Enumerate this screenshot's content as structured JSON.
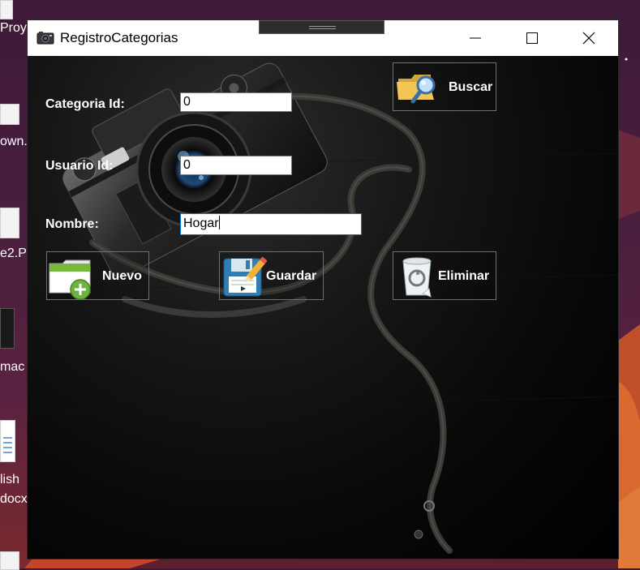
{
  "desktop": {
    "labels": [
      "Proy",
      "own..",
      "e2.P",
      "mac",
      "lish",
      "docx"
    ]
  },
  "window": {
    "title": "RegistroCategorias",
    "controls": {
      "minimize": "minimize-icon",
      "maximize": "maximize-icon",
      "close": "close-icon"
    }
  },
  "form": {
    "categoria_id": {
      "label": "Categoria Id:",
      "value": "0"
    },
    "usuario_id": {
      "label": "Usuario Id:",
      "value": "0"
    },
    "nombre": {
      "label": "Nombre:",
      "value": "Hogar"
    }
  },
  "buttons": {
    "buscar": {
      "label": "Buscar",
      "icon": "folder-search-icon"
    },
    "nuevo": {
      "label": "Nuevo",
      "icon": "new-folder-icon"
    },
    "guardar": {
      "label": "Guardar",
      "icon": "save-floppy-icon"
    },
    "eliminar": {
      "label": "Eliminar",
      "icon": "recycle-bin-icon"
    }
  },
  "colors": {
    "focus_border": "#0078d7",
    "window_bg": "#000000",
    "label_text": "#ffffff"
  }
}
